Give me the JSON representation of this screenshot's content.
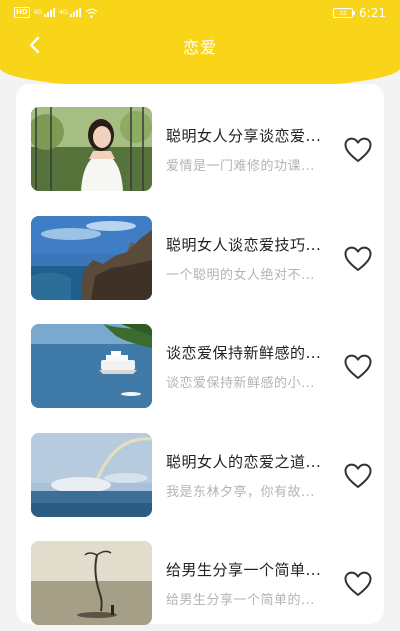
{
  "status_bar": {
    "network": "4G",
    "time": "6:21",
    "battery": "32"
  },
  "header": {
    "title": "恋爱"
  },
  "articles": [
    {
      "title": "聪明女人分享谈恋爱...",
      "desc": "爱情是一门难修的功课..."
    },
    {
      "title": "聪明女人谈恋爱技巧...",
      "desc": "一个聪明的女人绝对不..."
    },
    {
      "title": "谈恋爱保持新鲜感的...",
      "desc": "谈恋爱保持新鲜感的小..."
    },
    {
      "title": "聪明女人的恋爱之道...",
      "desc": "我是东林夕亭，你有故..."
    },
    {
      "title": "给男生分享一个简单...",
      "desc": "给男生分享一个简单的..."
    }
  ]
}
